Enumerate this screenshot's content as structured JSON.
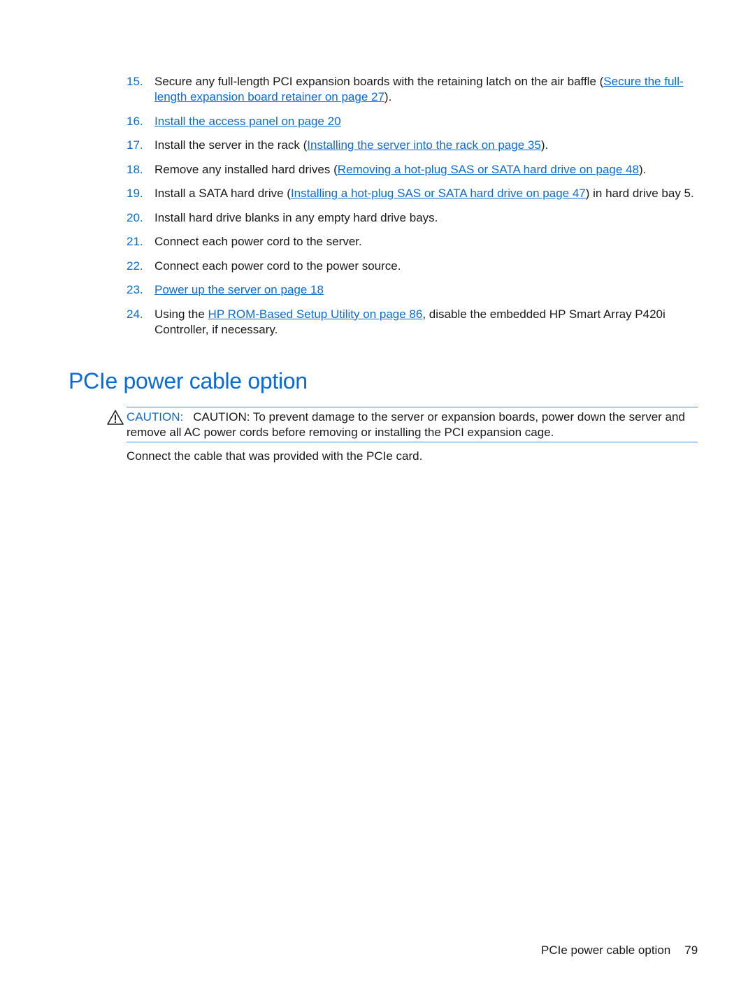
{
  "steps": [
    {
      "num": "15.",
      "pre": "Secure any full-length PCI expansion boards with the retaining latch on the air baffle (",
      "link": "Secure the full-length expansion board retainer on page 27",
      "post": ")."
    },
    {
      "num": "16.",
      "pre": "",
      "link": "Install the access panel on page 20",
      "post": ""
    },
    {
      "num": "17.",
      "pre": "Install the server in the rack (",
      "link": "Installing the server into the rack on page 35",
      "post": ")."
    },
    {
      "num": "18.",
      "pre": "Remove any installed hard drives (",
      "link": "Removing a hot-plug SAS or SATA hard drive on page 48",
      "post": ")."
    },
    {
      "num": "19.",
      "pre": "Install a SATA hard drive (",
      "link": "Installing a hot-plug SAS or SATA hard drive on page 47",
      "post": ") in hard drive bay 5."
    },
    {
      "num": "20.",
      "pre": "Install hard drive blanks in any empty hard drive bays.",
      "link": "",
      "post": ""
    },
    {
      "num": "21.",
      "pre": "Connect each power cord to the server.",
      "link": "",
      "post": ""
    },
    {
      "num": "22.",
      "pre": "Connect each power cord to the power source.",
      "link": "",
      "post": ""
    },
    {
      "num": "23.",
      "pre": "",
      "link": "Power up the server on page 18",
      "post": ""
    },
    {
      "num": "24.",
      "pre": "Using the ",
      "link": "HP ROM-Based Setup Utility on page 86",
      "post": ", disable the embedded HP Smart Array P420i Controller, if necessary."
    }
  ],
  "section": {
    "title": "PCIe power cable option",
    "caution_label": "CAUTION:",
    "caution_text": "CAUTION: To prevent damage to the server or expansion boards, power down the server and remove all AC power cords before removing or installing the PCI expansion cage.",
    "paragraph": "Connect the cable that was provided with the PCIe card."
  },
  "footer": {
    "title": "PCIe power cable option",
    "page": "79"
  }
}
